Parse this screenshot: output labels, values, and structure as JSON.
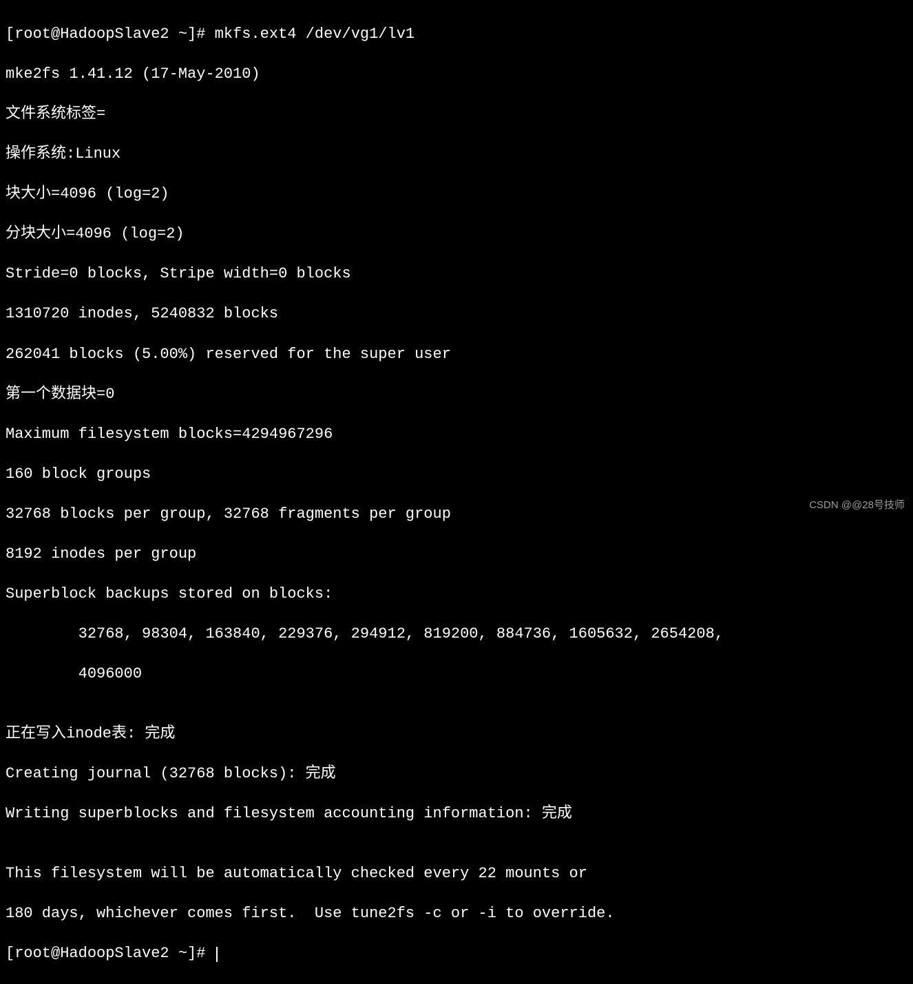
{
  "terminal": {
    "prompt1": "[root@HadoopSlave2 ~]# ",
    "command1": "mkfs.ext4 /dev/vg1/lv1",
    "lines": [
      "mke2fs 1.41.12 (17-May-2010)",
      "文件系统标签=",
      "操作系统:Linux",
      "块大小=4096 (log=2)",
      "分块大小=4096 (log=2)",
      "Stride=0 blocks, Stripe width=0 blocks",
      "1310720 inodes, 5240832 blocks",
      "262041 blocks (5.00%) reserved for the super user",
      "第一个数据块=0",
      "Maximum filesystem blocks=4294967296",
      "160 block groups",
      "32768 blocks per group, 32768 fragments per group",
      "8192 inodes per group",
      "Superblock backups stored on blocks: ",
      "        32768, 98304, 163840, 229376, 294912, 819200, 884736, 1605632, 2654208, ",
      "        4096000",
      "",
      "正在写入inode表: 完成                           ",
      "Creating journal (32768 blocks): 完成",
      "Writing superblocks and filesystem accounting information: 完成",
      "",
      "This filesystem will be automatically checked every 22 mounts or",
      "180 days, whichever comes first.  Use tune2fs -c or -i to override."
    ],
    "prompt2": "[root@HadoopSlave2 ~]# "
  },
  "watermark": "CSDN @@28号技师"
}
